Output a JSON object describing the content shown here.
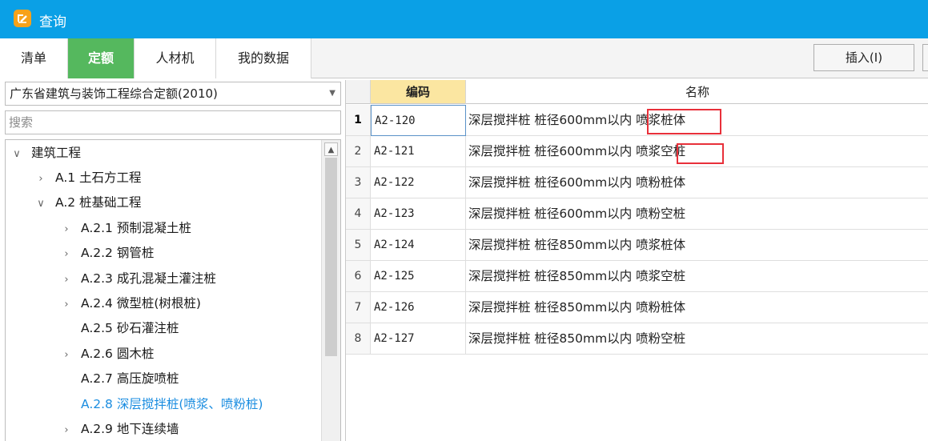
{
  "window": {
    "title": "查询",
    "accent": "#0aa0e6",
    "icon": "pen-icon"
  },
  "tabs": [
    {
      "label": "清单",
      "active": false
    },
    {
      "label": "定额",
      "active": true
    },
    {
      "label": "人材机",
      "active": false
    },
    {
      "label": "我的数据",
      "active": false
    }
  ],
  "toolbar": {
    "insert_label": "插入(I)"
  },
  "left_panel": {
    "quota_select": {
      "value": "广东省建筑与装饰工程综合定额(2010)"
    },
    "search": {
      "placeholder": "搜索",
      "value": ""
    },
    "tree": [
      {
        "label": "建筑工程",
        "expanded": true,
        "level": 0
      },
      {
        "label": "A.1 土石方工程",
        "expanded": false,
        "level": 1
      },
      {
        "label": "A.2 桩基础工程",
        "expanded": true,
        "level": 1
      },
      {
        "label": "A.2.1 预制混凝土桩",
        "expanded": false,
        "level": 2
      },
      {
        "label": "A.2.2 钢管桩",
        "expanded": false,
        "level": 2
      },
      {
        "label": "A.2.3 成孔混凝土灌注桩",
        "expanded": false,
        "level": 2
      },
      {
        "label": "A.2.4 微型桩(树根桩)",
        "expanded": false,
        "level": 2
      },
      {
        "label": "A.2.5 砂石灌注桩",
        "expanded": null,
        "level": 2
      },
      {
        "label": "A.2.6 圆木桩",
        "expanded": false,
        "level": 2
      },
      {
        "label": "A.2.7 高压旋喷桩",
        "expanded": null,
        "level": 2
      },
      {
        "label": "A.2.8 深层搅拌桩(喷浆、喷粉桩)",
        "expanded": null,
        "level": 2,
        "selected": true
      },
      {
        "label": "A.2.9 地下连续墙",
        "expanded": false,
        "level": 2
      }
    ]
  },
  "grid": {
    "headers": {
      "num": "",
      "code": "编码",
      "name": "名称"
    },
    "rows": [
      {
        "num": "1",
        "code": "A2-120",
        "name": "深层搅拌桩 桩径600mm以内 喷浆桩体"
      },
      {
        "num": "2",
        "code": "A2-121",
        "name": "深层搅拌桩 桩径600mm以内 喷浆空桩"
      },
      {
        "num": "3",
        "code": "A2-122",
        "name": "深层搅拌桩 桩径600mm以内 喷粉桩体"
      },
      {
        "num": "4",
        "code": "A2-123",
        "name": "深层搅拌桩 桩径600mm以内 喷粉空桩"
      },
      {
        "num": "5",
        "code": "A2-124",
        "name": "深层搅拌桩 桩径850mm以内 喷浆桩体"
      },
      {
        "num": "6",
        "code": "A2-125",
        "name": "深层搅拌桩 桩径850mm以内 喷浆空桩"
      },
      {
        "num": "7",
        "code": "A2-126",
        "name": "深层搅拌桩 桩径850mm以内 喷粉桩体"
      },
      {
        "num": "8",
        "code": "A2-127",
        "name": "深层搅拌桩 桩径850mm以内 喷粉空桩"
      }
    ]
  },
  "colors": {
    "tab_active": "#55b85e",
    "selected_tree": "#1b8de0",
    "code_header": "#fbe6a1",
    "highlight_box": "#e8303a"
  }
}
